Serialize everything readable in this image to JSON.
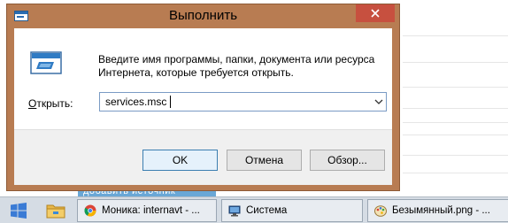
{
  "dialog": {
    "title": "Выполнить",
    "description": "Введите имя программы, папки, документа или ресурса Интернета, которые требуется открыть.",
    "open_label_mnemonic": "О",
    "open_label_rest": "ткрыть:",
    "open_value": "services.msc",
    "ok_label": "OK",
    "cancel_label": "Отмена",
    "browse_label": "Обзор...",
    "accent_color": "#b87c52"
  },
  "background": {
    "link_text": "добавить источник"
  },
  "taskbar": {
    "items": [
      {
        "label": "Моника: internavt - ...",
        "icon": "chrome-icon"
      },
      {
        "label": "Система",
        "icon": "system-icon"
      },
      {
        "label": "Безымянный.png - ...",
        "icon": "paint-icon"
      }
    ]
  }
}
